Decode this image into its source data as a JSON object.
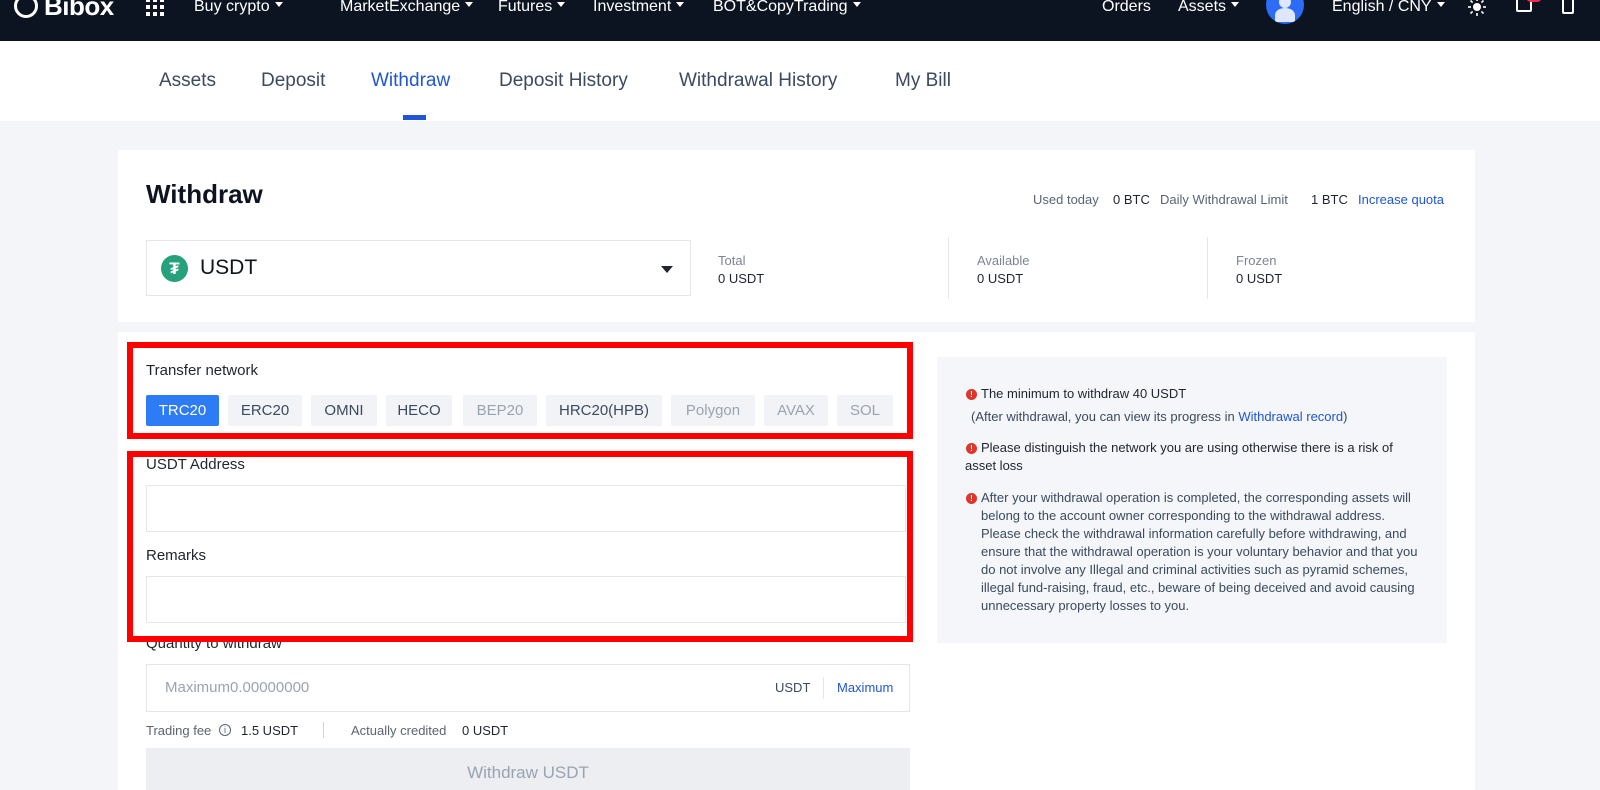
{
  "nav": {
    "logo_text": "Bibox",
    "items": [
      "Buy crypto",
      "Market",
      "Exchange",
      "Futures",
      "Investment",
      "BOT&CopyTrading"
    ],
    "right": {
      "orders": "Orders",
      "assets": "Assets",
      "language": "English / CNY"
    }
  },
  "tabs": [
    "Assets",
    "Deposit",
    "Withdraw",
    "Deposit History",
    "Withdrawal History",
    "My Bill"
  ],
  "active_tab": "Withdraw",
  "withdraw": {
    "title": "Withdraw",
    "used_today_label": "Used today",
    "used_today_value": "0 BTC",
    "daily_limit_label": "Daily Withdrawal Limit",
    "daily_limit_value": "1 BTC",
    "increase_quota": "Increase quota",
    "coin": "USDT",
    "coin_logo": "₮",
    "stats": [
      {
        "label": "Total",
        "value": "0 USDT"
      },
      {
        "label": "Available",
        "value": "0 USDT"
      },
      {
        "label": "Frozen",
        "value": "0 USDT"
      }
    ],
    "network_label": "Transfer network",
    "networks": [
      "TRC20",
      "ERC20",
      "OMNI",
      "HECO",
      "BEP20",
      "HRC20(HPB)",
      "Polygon",
      "AVAX",
      "SOL"
    ],
    "selected_network": "TRC20",
    "address_label": "USDT Address",
    "address_value": "",
    "remarks_label": "Remarks",
    "remarks_value": "",
    "quantity_label": "Quantity to withdraw",
    "quantity_placeholder": "Maximum0.00000000",
    "quantity_unit": "USDT",
    "maximum_link": "Maximum",
    "fee_label": "Trading fee",
    "fee_value": "1.5 USDT",
    "credited_label": "Actually credited",
    "credited_value": "0 USDT",
    "submit_label": "Withdraw USDT"
  },
  "notices": {
    "n1": "The minimum to withdraw 40 USDT",
    "n1_sub_prefix": "(After withdrawal, you can view its progress in ",
    "n1_sub_link": "Withdrawal record",
    "n1_sub_suffix": ")",
    "n2": "Please distinguish the network you are using otherwise there is a risk of asset loss",
    "n3": "After your withdrawal operation is completed, the corresponding assets will belong to the account owner corresponding to the withdrawal address. Please check the withdrawal information carefully before withdrawing, and ensure that the withdrawal operation is your voluntary behavior and that you do not involve any Illegal and criminal activities such as pyramid schemes, illegal fund-raising, fraud, etc., beware of being deceived and avoid causing unnecessary property losses to you."
  },
  "colors": {
    "nav_bg": "#0d1421",
    "accent": "#1f55d6",
    "active_network": "#2d7cf6",
    "highlight": "#ff0000",
    "usdt_green": "#26a17b",
    "warning": "#e0352b"
  }
}
